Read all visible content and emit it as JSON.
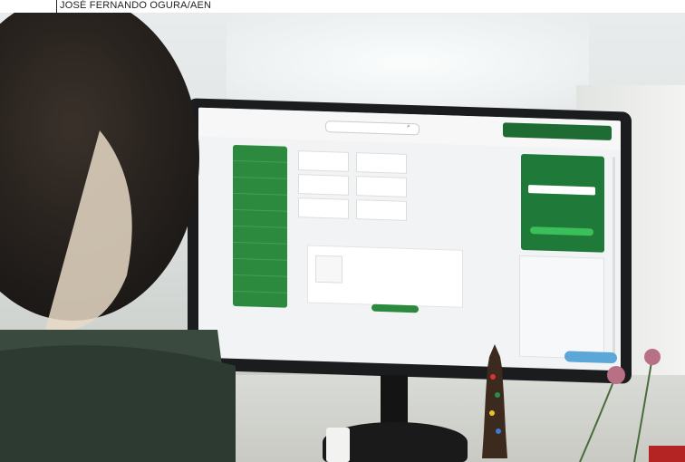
{
  "photo_credit": "JOSÉ FERNANDO OGURA/AEN"
}
